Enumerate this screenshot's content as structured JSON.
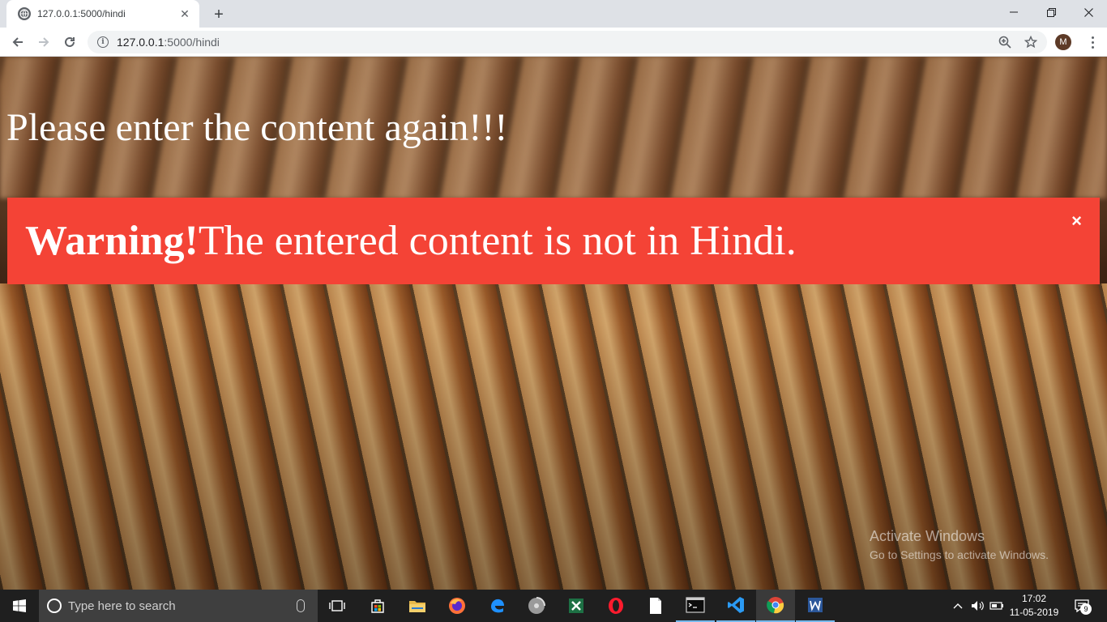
{
  "browser": {
    "tab": {
      "title": "127.0.0.1:5000/hindi",
      "favicon": "globe-icon"
    },
    "address": {
      "host": "127.0.0.1",
      "path": ":5000/hindi"
    },
    "profile_initial": "M"
  },
  "page": {
    "heading": "Please enter the content again!!!",
    "alert": {
      "strong": "Warning!",
      "message": "The entered content is not in Hindi.",
      "close": "×",
      "color": "#f44336"
    }
  },
  "watermark": {
    "title": "Activate Windows",
    "subtitle": "Go to Settings to activate Windows."
  },
  "taskbar": {
    "search_placeholder": "Type here to search",
    "time": "17:02",
    "date": "11-05-2019",
    "notifications": "9",
    "apps": [
      "task-view",
      "store",
      "file-explorer",
      "firefox",
      "edge",
      "media-player",
      "excel",
      "opera",
      "notepad",
      "terminal",
      "vscode",
      "chrome",
      "word"
    ]
  }
}
